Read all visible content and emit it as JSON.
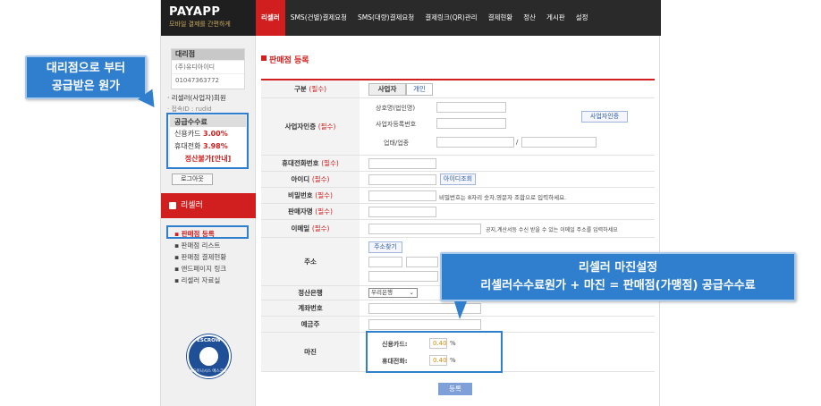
{
  "header": {
    "logo_title": "PAYAPP",
    "logo_tagline": "모바일 결제를 간편하게",
    "nav": [
      "리셀러",
      "SMS(건별)결제요청",
      "SMS(대량)결제요청",
      "결제링크(QR)관리",
      "결제현황",
      "정산",
      "게시판",
      "설정"
    ]
  },
  "sidebar": {
    "agency_header": "대리점",
    "agency_name": "(주)유디아이디",
    "agency_phone": "01047363772",
    "link_reseller_member": "리셀러(사업자)회원",
    "link_login_id": "접속ID : rudid",
    "fee_header": "공급수수료",
    "fee_card_label": "신용카드",
    "fee_card_value": "3.00%",
    "fee_phone_label": "휴대전화",
    "fee_phone_value": "3.98%",
    "fee_notice": "정산불가[안내]",
    "logout": "로그아웃",
    "reseller_title": "리셀러",
    "menu": [
      "판매점 등록",
      "판매점 리스트",
      "판매점 결제현황",
      "앤드페이지 링크",
      "리셀러 자료실"
    ],
    "escrow_top": "ESCROW",
    "escrow_bottom": "KG이니시스 에스크로"
  },
  "main": {
    "page_title": "판매점 등록",
    "labels": {
      "category": "구분",
      "business": "사업자인증",
      "phone": "휴대전화번호",
      "id": "아이디",
      "password": "비밀번호",
      "seller_name": "판매자명",
      "email": "이메일",
      "address": "주소",
      "bank": "정산은행",
      "account": "계좌번호",
      "depositor": "예금주",
      "margin": "마진"
    },
    "required_tag": "(필수)",
    "category_tabs": [
      "사업자",
      "개인"
    ],
    "business_fields": [
      "상호명(법인명)",
      "사업자등록번호",
      "업태/업종"
    ],
    "business_slash": "/",
    "business_verify_btn": "사업자인증",
    "id_check_btn": "아이디조회",
    "password_hint": "비밀번호는 8자리 숫자,영문자 조합으로 입력하세요.",
    "email_hint": "공지,계산서등 수신 받을 수 있는 이메일 주소를 입력하세요",
    "address_btn": "주소찾기",
    "bank_selected": "우리은행",
    "margin_card_label": "신용카드:",
    "margin_card_value": "0.40",
    "margin_phone_label": "휴대전화:",
    "margin_phone_value": "0.40",
    "percent": "%",
    "submit": "등록"
  },
  "callouts": {
    "left": [
      "대리점으로 부터",
      "공급받은 원가"
    ],
    "right": [
      "리셀러 마진설정",
      "리셀러수수료원가 + 마진 = 판매점(가맹점) 공급수수료"
    ]
  },
  "colors": {
    "accent": "#d11f1f",
    "callout": "#2f7fce",
    "nav_bg": "#2a2a2a"
  }
}
